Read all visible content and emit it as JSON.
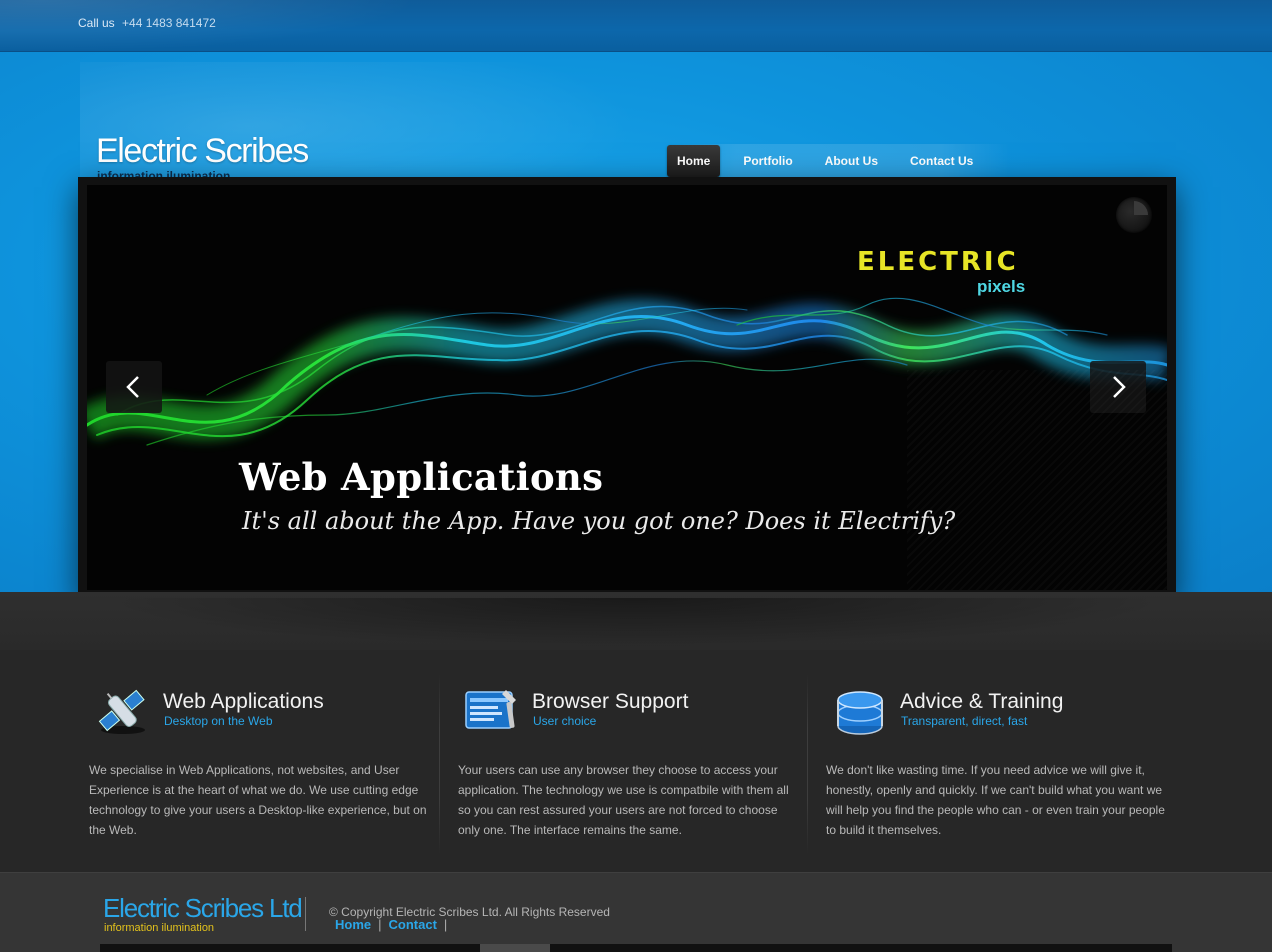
{
  "topbar": {
    "call_label": "Call us",
    "phone": "+44 1483 841472"
  },
  "header": {
    "logo_title": "Electric Scribes",
    "logo_tagline": "information ilumination",
    "nav": [
      {
        "label": "Home",
        "active": true
      },
      {
        "label": "Portfolio",
        "active": false
      },
      {
        "label": "About Us",
        "active": false
      },
      {
        "label": "Contact Us",
        "active": false
      }
    ]
  },
  "slider": {
    "brand_top": "Electric",
    "brand_sub": "pixels",
    "heading": "Web Applications",
    "text": "It's all about the App.  Have you got one?  Does it Electrify?",
    "prev_icon": "chevron-left-icon",
    "next_icon": "chevron-right-icon"
  },
  "features": [
    {
      "icon": "satellite-icon",
      "title": "Web Applications",
      "subtitle": "Desktop on the Web",
      "body": "We specialise in Web Applications, not websites, and User Experience is at the heart of what we do. We use cutting edge technology to give your users a Desktop-like experience, but on the Web."
    },
    {
      "icon": "browser-tools-icon",
      "title": "Browser Support",
      "subtitle": "User choice",
      "body": "Your users can use any browser they choose to access your application. The technology we use is compatbile with them all so you can rest assured your users are not forced to choose only one. The interface remains the same."
    },
    {
      "icon": "database-icon",
      "title": "Advice & Training",
      "subtitle": "Transparent, direct, fast",
      "body": "We don't like wasting time. If you need advice we will give it, honestly, openly and quickly.  If we can't build what you want we will help you find the people who can - or even train your people to build it themselves."
    }
  ],
  "footer": {
    "logo_title": "Electric Scribes Ltd",
    "logo_tagline": "information ilumination",
    "copyright": "© Copyright Electric Scribes Ltd. All Rights Reserved",
    "links": [
      {
        "label": "Home"
      },
      {
        "label": "Contact"
      }
    ]
  },
  "colors": {
    "accent_blue": "#2aa6e8",
    "header_blue": "#0e93dc",
    "dark_bg": "#272727",
    "brand_yellow": "#e7e526"
  }
}
